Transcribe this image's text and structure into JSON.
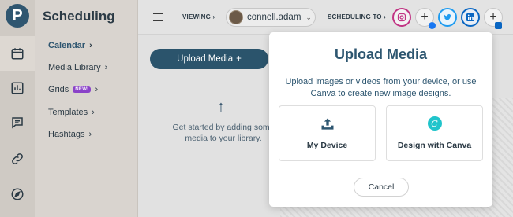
{
  "app": {
    "logo_letter": "P",
    "title": "Scheduling"
  },
  "nav": {
    "items": [
      {
        "label": "Calendar",
        "active": true,
        "badge": ""
      },
      {
        "label": "Media Library",
        "active": false,
        "badge": ""
      },
      {
        "label": "Grids",
        "active": false,
        "badge": "NEW!"
      },
      {
        "label": "Templates",
        "active": false,
        "badge": ""
      },
      {
        "label": "Hashtags",
        "active": false,
        "badge": ""
      }
    ]
  },
  "topbar": {
    "viewing_label": "VIEWING",
    "username": "connell.adam",
    "scheduling_label": "SCHEDULING TO",
    "networks": [
      "instagram-icon",
      "facebook-icon",
      "twitter-icon",
      "linkedin-icon"
    ]
  },
  "content": {
    "upload_button_label": "Upload Media",
    "empty_state_text": "Get started by adding some media to your library."
  },
  "modal": {
    "title": "Upload Media",
    "description": "Upload images or videos from your device, or use Canva to create new image designs.",
    "option_device": "My Device",
    "option_canva": "Design with Canva",
    "canva_letter": "C",
    "cancel_label": "Cancel"
  },
  "colors": {
    "primary": "#2b546c",
    "accent_new": "#8a42c8",
    "canva": "#20c4cb"
  }
}
